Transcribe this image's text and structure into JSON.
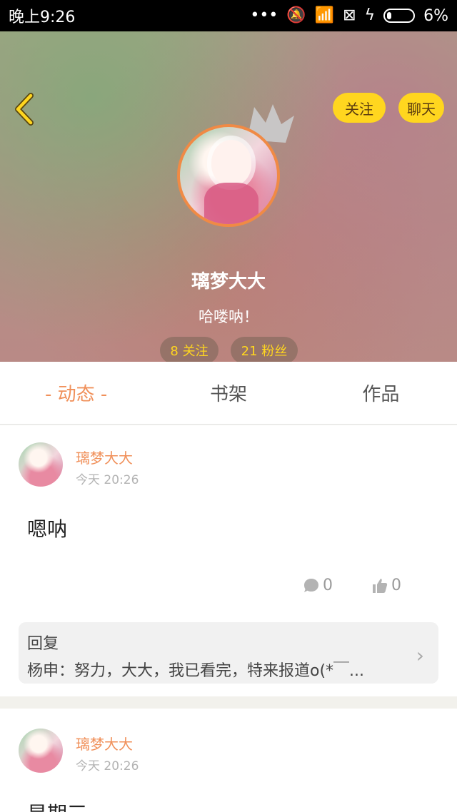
{
  "status_bar": {
    "time": "晚上9:26",
    "battery": "6%"
  },
  "header": {
    "follow_label": "关注",
    "chat_label": "聊天",
    "name": "璃梦大大",
    "bio": "哈喽呐！",
    "following": "8 关注",
    "fans": "21 粉丝"
  },
  "tabs": [
    {
      "label": "- 动态 -",
      "active": true
    },
    {
      "label": "书架",
      "active": false
    },
    {
      "label": "作品",
      "active": false
    }
  ],
  "posts": [
    {
      "author": "璃梦大大",
      "time": "今天 20:26",
      "content": "嗯呐",
      "comments": "0",
      "likes": "0",
      "reply": {
        "title": "回复",
        "text": "杨申：努力，大大，我已看完，特来报道o(*￣..."
      }
    },
    {
      "author": "璃梦大大",
      "time": "今天 20:26",
      "content": "星期三"
    }
  ],
  "colors": {
    "accent_orange": "#f0905a",
    "yellow": "#ffd61f"
  }
}
